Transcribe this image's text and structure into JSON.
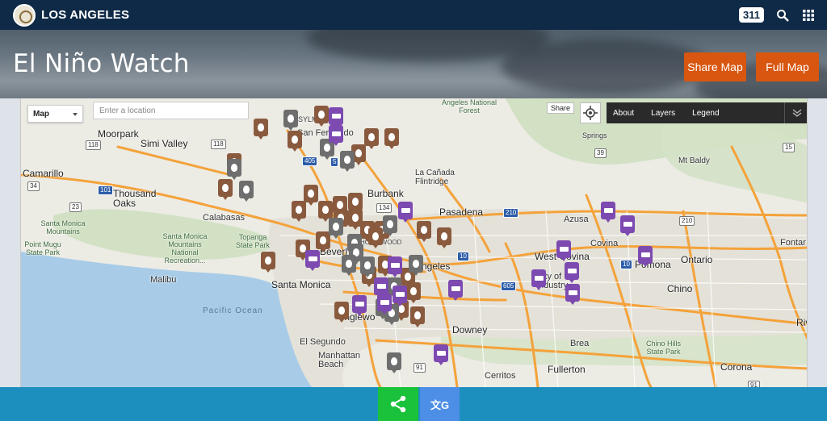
{
  "header": {
    "brand": "LOS ANGELES",
    "badge_311": "311",
    "icons": [
      "search-icon",
      "apps-grid-icon"
    ]
  },
  "banner": {
    "title": "El Niño Watch",
    "share_map_label": "Share Map",
    "full_map_label": "Full Map"
  },
  "map": {
    "type_selector": "Map",
    "location_placeholder": "Enter a location",
    "share_chip": "Share",
    "panel_tabs": [
      "About",
      "Layers",
      "Legend"
    ],
    "labels": {
      "moorpark": "Moorpark",
      "simi_valley": "Simi Valley",
      "camarillo": "Camarillo",
      "thousand_oaks": "Thousand Oaks",
      "santa_monica_mountains": "Santa Monica Mountains",
      "point_mugu": "Point Mugu State Park",
      "smm_nra": "Santa Monica Mountains National Recreation...",
      "calabasas": "Calabasas",
      "topanga": "Topanga State Park",
      "malibu": "Malibu",
      "santa_monica": "Santa Monica",
      "pacific_ocean": "Pacific Ocean",
      "sylmar": "SYLMAR",
      "san_fernando": "San Fernando",
      "angeles_nf": "Angeles National Forest",
      "la_canada": "La Cañada Flintridge",
      "burbank": "Burbank",
      "pasadena": "Pasadena",
      "hollywood": "HOLLYWOOD",
      "beverly": "Beverl",
      "los_angeles": "Angeles",
      "inglewood": "Inglewo",
      "el_segundo": "El Segundo",
      "manhattan_beach": "Manhattan Beach",
      "downey": "Downey",
      "cerritos": "Cerritos",
      "fullerton": "Fullerton",
      "brea": "Brea",
      "azusa": "Azusa",
      "west_covina": "West Covina",
      "city_of_industry": "City of Industry",
      "pomona": "Pomona",
      "ontario": "Ontario",
      "chino": "Chino",
      "chino_hills": "Chino Hills State Park",
      "corona": "Corona",
      "covina": "Covina",
      "mt_baldy": "Mt Baldy",
      "fontana": "Fontar",
      "riverside": "Riv",
      "pine_springs": "Springs"
    },
    "markers": {
      "bag_count": 30,
      "bulb_count": 16,
      "bed_count": 18
    },
    "colors": {
      "bag": "#8a5a3e",
      "bulb": "#6e6e6e",
      "bed": "#7c4ab0"
    }
  },
  "footer": {
    "share_icon": "share-icon",
    "translate_icon": "translate-icon",
    "translate_glyph": "文G"
  }
}
